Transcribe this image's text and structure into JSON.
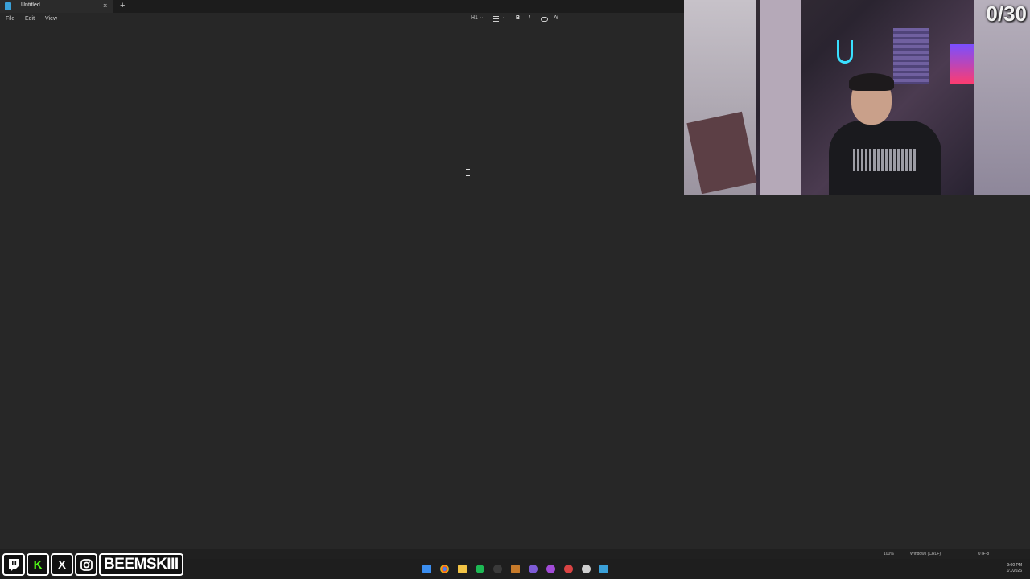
{
  "tab": {
    "title": "Untitled",
    "close_glyph": "×",
    "new_tab_glyph": "+"
  },
  "menu": {
    "items": [
      "File",
      "Edit",
      "View"
    ]
  },
  "toolbar": {
    "heading": "H1",
    "heading_chevron": "⌄",
    "list_chevron": "⌄",
    "bold": "B",
    "italic": "I",
    "clear_format": "A̸"
  },
  "overlay": {
    "counter": "0/30",
    "handle": "BEEMSKIII",
    "socials": [
      "twitch-icon",
      "kick-icon",
      "x-icon",
      "instagram-icon"
    ],
    "kick_letter": "K",
    "x_letter": "X"
  },
  "status": {
    "zoom": "100%",
    "line_endings": "Windows (CRLF)",
    "encoding": "UTF-8"
  },
  "taskbar": {
    "time": "9:00 PM",
    "date": "1/1/2026",
    "icons": [
      "windows-start-icon",
      "chrome-icon",
      "file-explorer-icon",
      "spotify-icon",
      "obs-icon",
      "app-icon",
      "proton-icon",
      "messenger-icon",
      "recorder-icon",
      "steam-icon",
      "notepad-icon"
    ]
  },
  "colors": {
    "background": "#272727",
    "accent": "#3aa0d8"
  }
}
